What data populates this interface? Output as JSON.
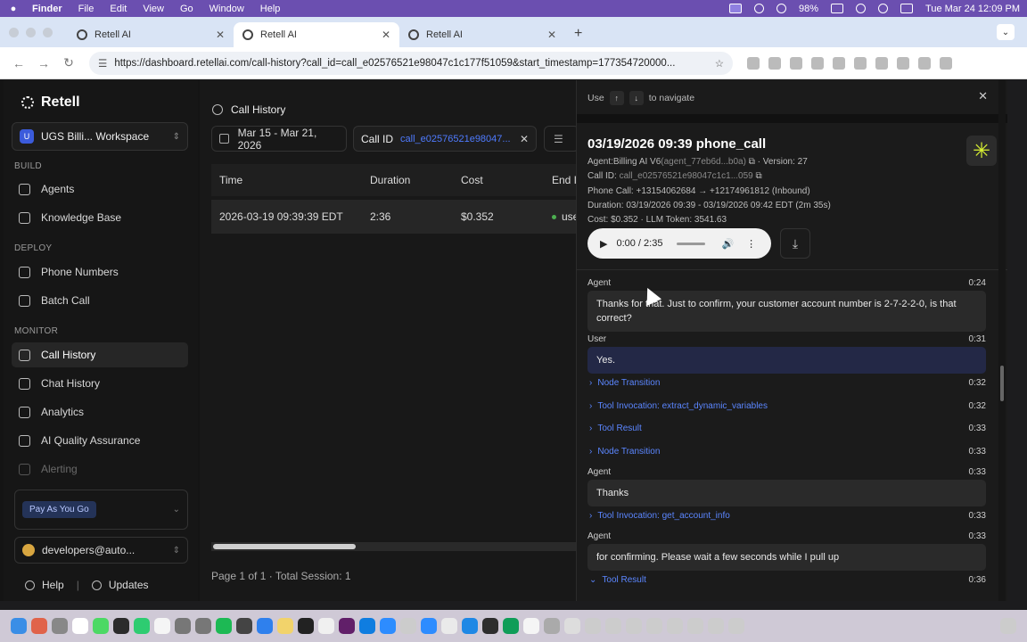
{
  "menubar": {
    "app_name": "Finder",
    "menus": [
      "File",
      "Edit",
      "View",
      "Go",
      "Window",
      "Help"
    ],
    "battery": "98%",
    "datetime": "Tue Mar 24  12:09 PM"
  },
  "browser": {
    "tabs": [
      {
        "title": "Retell AI"
      },
      {
        "title": "Retell AI"
      },
      {
        "title": "Retell AI"
      }
    ],
    "url": "https://dashboard.retellai.com/call-history?call_id=call_e02576521e98047c1c177f51059&start_timestamp=177354720000..."
  },
  "sidebar": {
    "brand": "Retell",
    "workspace": {
      "badge": "U",
      "name": "UGS Billi... Workspace"
    },
    "sections": {
      "build": "BUILD",
      "deploy": "DEPLOY",
      "monitor": "MONITOR"
    },
    "build_items": [
      "Agents",
      "Knowledge Base"
    ],
    "deploy_items": [
      "Phone Numbers",
      "Batch Call"
    ],
    "monitor_items": [
      "Call History",
      "Chat History",
      "Analytics",
      "AI Quality Assurance",
      "Alerting"
    ],
    "plan": "Pay As You Go",
    "account": "developers@auto...",
    "help": "Help",
    "updates": "Updates"
  },
  "main": {
    "title": "Call History",
    "date_filter": "Mar 15 - Mar 21, 2026",
    "callid_label": "Call ID",
    "callid_value": "call_e02576521e98047...",
    "columns": [
      "Time",
      "Duration",
      "Cost",
      "End I"
    ],
    "rows": [
      {
        "time": "2026-03-19 09:39:39 EDT",
        "duration": "2:36",
        "cost": "$0.352",
        "end": "use"
      }
    ],
    "pager": "Page 1 of 1 · Total Session: 1"
  },
  "panel": {
    "nav_use": "Use",
    "nav_to": "to navigate",
    "title": "03/19/2026 09:39 phone_call",
    "agent_label": "Agent:Billing AI V6",
    "agent_id": "(agent_77eb6d...b0a)",
    "version": "Version: 27",
    "call_id_label": "Call ID:",
    "call_id": "call_e02576521e98047c1c1...059",
    "phone_call": "Phone Call: +13154062684 → +12174961812 (Inbound)",
    "duration": "Duration: 03/19/2026 09:39 - 03/19/2026 09:42 EDT (2m 35s)",
    "cost": "Cost: $0.352",
    "llm_token": "LLM Token: 3541.63",
    "player_time": "0:00 / 2:35",
    "transcript": [
      {
        "kind": "msg",
        "speaker": "Agent",
        "time": "0:24",
        "text": "Thanks for that. Just to confirm, your customer account number is 2-7-2-2-0, is that correct?"
      },
      {
        "kind": "msg",
        "speaker": "User",
        "time": "0:31",
        "text": "Yes."
      },
      {
        "kind": "event",
        "label": "Node Transition",
        "time": "0:32"
      },
      {
        "kind": "event",
        "label": "Tool Invocation: extract_dynamic_variables",
        "time": "0:32"
      },
      {
        "kind": "event",
        "label": "Tool Result",
        "time": "0:33"
      },
      {
        "kind": "event",
        "label": "Node Transition",
        "time": "0:33"
      },
      {
        "kind": "msg",
        "speaker": "Agent",
        "time": "0:33",
        "text": "Thanks"
      },
      {
        "kind": "event",
        "label": "Tool Invocation: get_account_info",
        "time": "0:33"
      },
      {
        "kind": "msg",
        "speaker": "Agent",
        "time": "0:33",
        "text": "for confirming. Please wait a few seconds while I pull up"
      },
      {
        "kind": "event",
        "label": "Tool Result",
        "time": "0:36"
      }
    ]
  }
}
